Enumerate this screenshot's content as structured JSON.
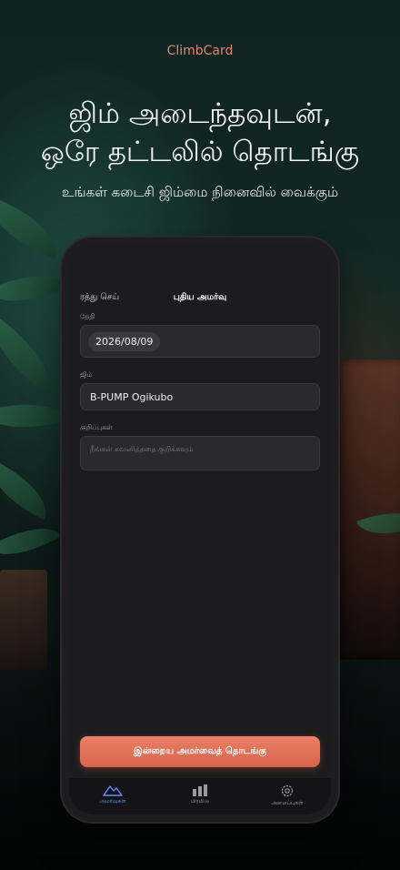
{
  "brand": "ClimbCard",
  "headline": {
    "line1": "ஜிம் அடைந்தவுடன்,",
    "line2": "ஒரே தட்டலில் தொடங்கு"
  },
  "subline": "உங்கள் கடைசி ஜிம்மை நினைவில் வைக்கும்",
  "app": {
    "cancel_label": "ரத்து செய்",
    "screen_title": "புதிய அமர்வு",
    "date": {
      "label": "தேதி",
      "value": "2026/08/09"
    },
    "gym": {
      "label": "ஜிம்",
      "value": "B-PUMP Ogikubo"
    },
    "notes": {
      "label": "குறிப்புகள்",
      "placeholder": "நீங்கள் கவனித்ததை குறிக்கவும்"
    },
    "cta_label": "இன்றைய அமர்வைத் தொடங்கு",
    "tabs": [
      {
        "label": "அமர்வுகள்",
        "icon": "mountains-icon",
        "active": true
      },
      {
        "label": "பிரமிடு",
        "icon": "bar-chart-icon",
        "active": false
      },
      {
        "label": "அமைப்புகள்",
        "icon": "gear-icon",
        "active": false
      }
    ]
  },
  "colors": {
    "accent": "#e8826a",
    "tab_active": "#5f8cff"
  }
}
